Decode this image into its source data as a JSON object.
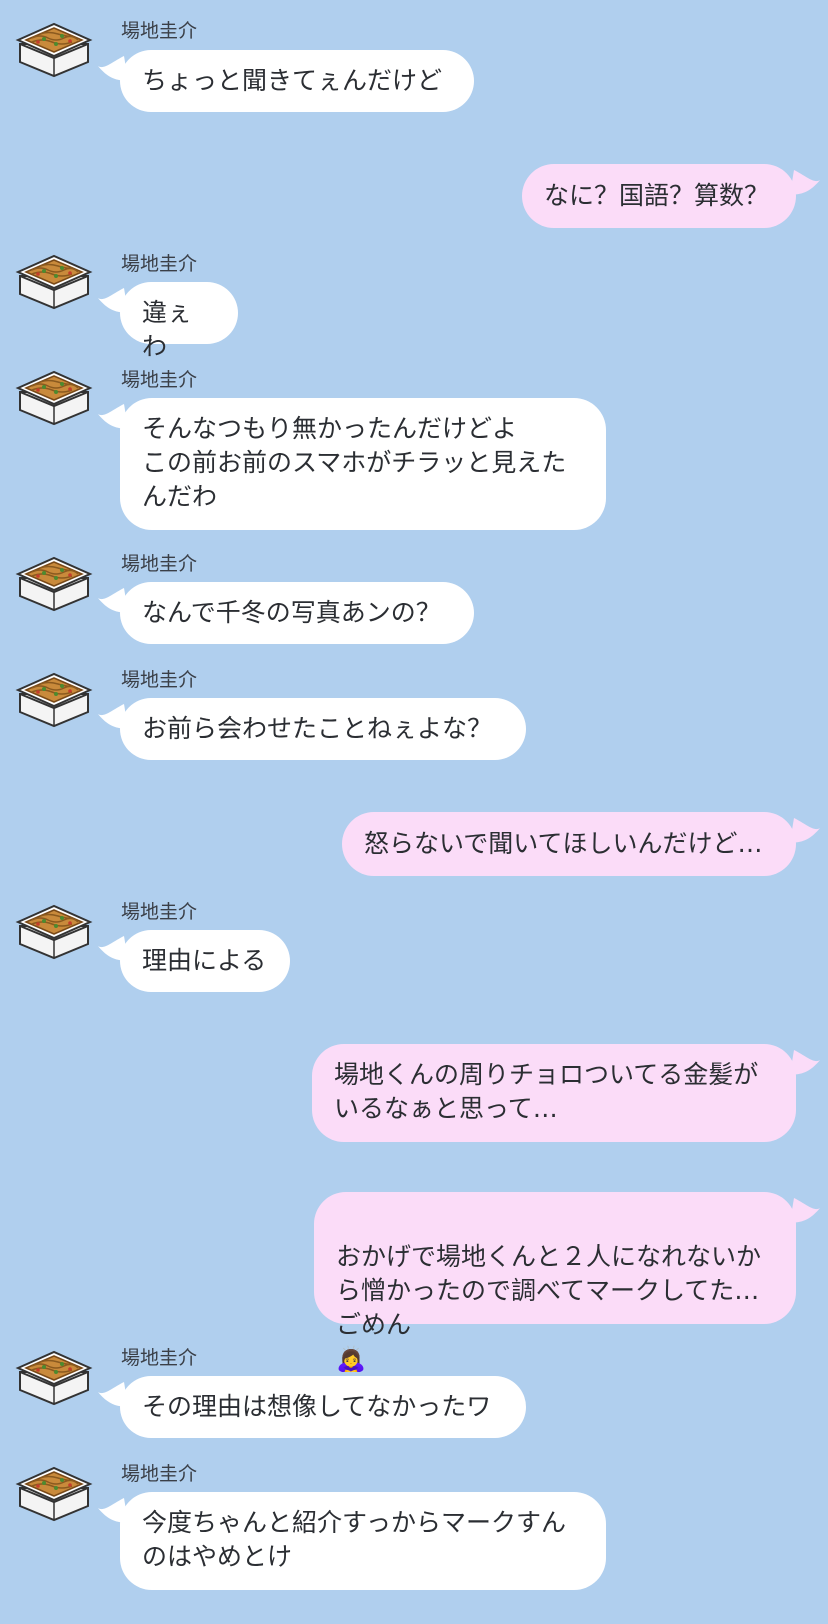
{
  "colors": {
    "background": "#b0cfee",
    "incoming_bubble": "#ffffff",
    "outgoing_bubble": "#fbdcf8"
  },
  "avatar_icon": "yakisoba-container-icon",
  "contact_name": "場地圭介",
  "messages": [
    {
      "from": "contact",
      "text": "ちょっと聞きてぇんだけど"
    },
    {
      "from": "me",
      "text": "なに？国語？算数？"
    },
    {
      "from": "contact",
      "text": "違ぇわ"
    },
    {
      "from": "contact",
      "text": "そんなつもり無かったんだけどよ\nこの前お前のスマホがチラッと見えた\nんだわ"
    },
    {
      "from": "contact",
      "text": "なんで千冬の写真あンの？"
    },
    {
      "from": "contact",
      "text": "お前ら会わせたことねぇよな？"
    },
    {
      "from": "me",
      "text": "怒らないで聞いてほしいんだけど…"
    },
    {
      "from": "contact",
      "text": "理由による"
    },
    {
      "from": "me",
      "text": "場地くんの周りチョロついてる金髪が\nいるなぁと思って…"
    },
    {
      "from": "me",
      "text": "おかげで場地くんと２人になれないか\nら憎かったので調べてマークしてた…\nごめん",
      "emoji": "🙇‍♀️"
    },
    {
      "from": "contact",
      "text": "その理由は想像してなかったワ"
    },
    {
      "from": "contact",
      "text": "今度ちゃんと紹介すっからマークすん\nのはやめとけ"
    }
  ]
}
